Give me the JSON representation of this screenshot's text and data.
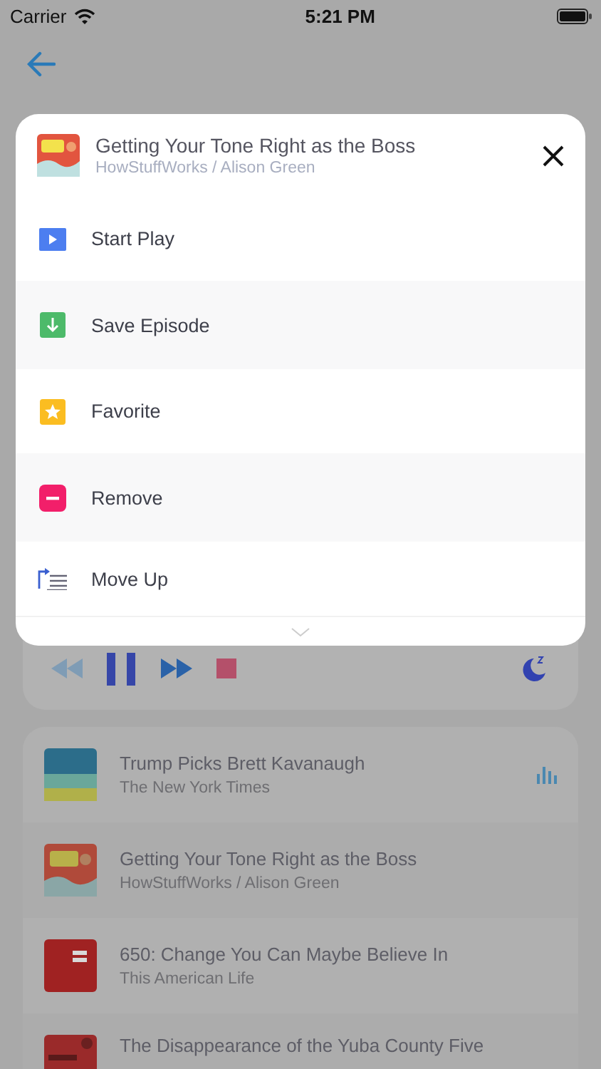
{
  "status_bar": {
    "carrier": "Carrier",
    "time": "5:21 PM"
  },
  "modal": {
    "title": "Getting Your Tone Right as the Boss",
    "subtitle": "HowStuffWorks / Alison Green",
    "actions": [
      {
        "label": "Start Play",
        "kind": "play"
      },
      {
        "label": "Save Episode",
        "kind": "save"
      },
      {
        "label": "Favorite",
        "kind": "favorite"
      },
      {
        "label": "Remove",
        "kind": "remove"
      },
      {
        "label": "Move Up",
        "kind": "move-up"
      }
    ]
  },
  "queue": [
    {
      "title": "Trump Picks Brett Kavanaugh",
      "subtitle": "The New York Times",
      "playing": true
    },
    {
      "title": "Getting Your Tone Right as the Boss",
      "subtitle": "HowStuffWorks / Alison Green",
      "playing": false
    },
    {
      "title": "650: Change You Can Maybe Believe In",
      "subtitle": "This American Life",
      "playing": false
    },
    {
      "title": "The Disappearance of the Yuba County Five",
      "playing": false
    }
  ]
}
